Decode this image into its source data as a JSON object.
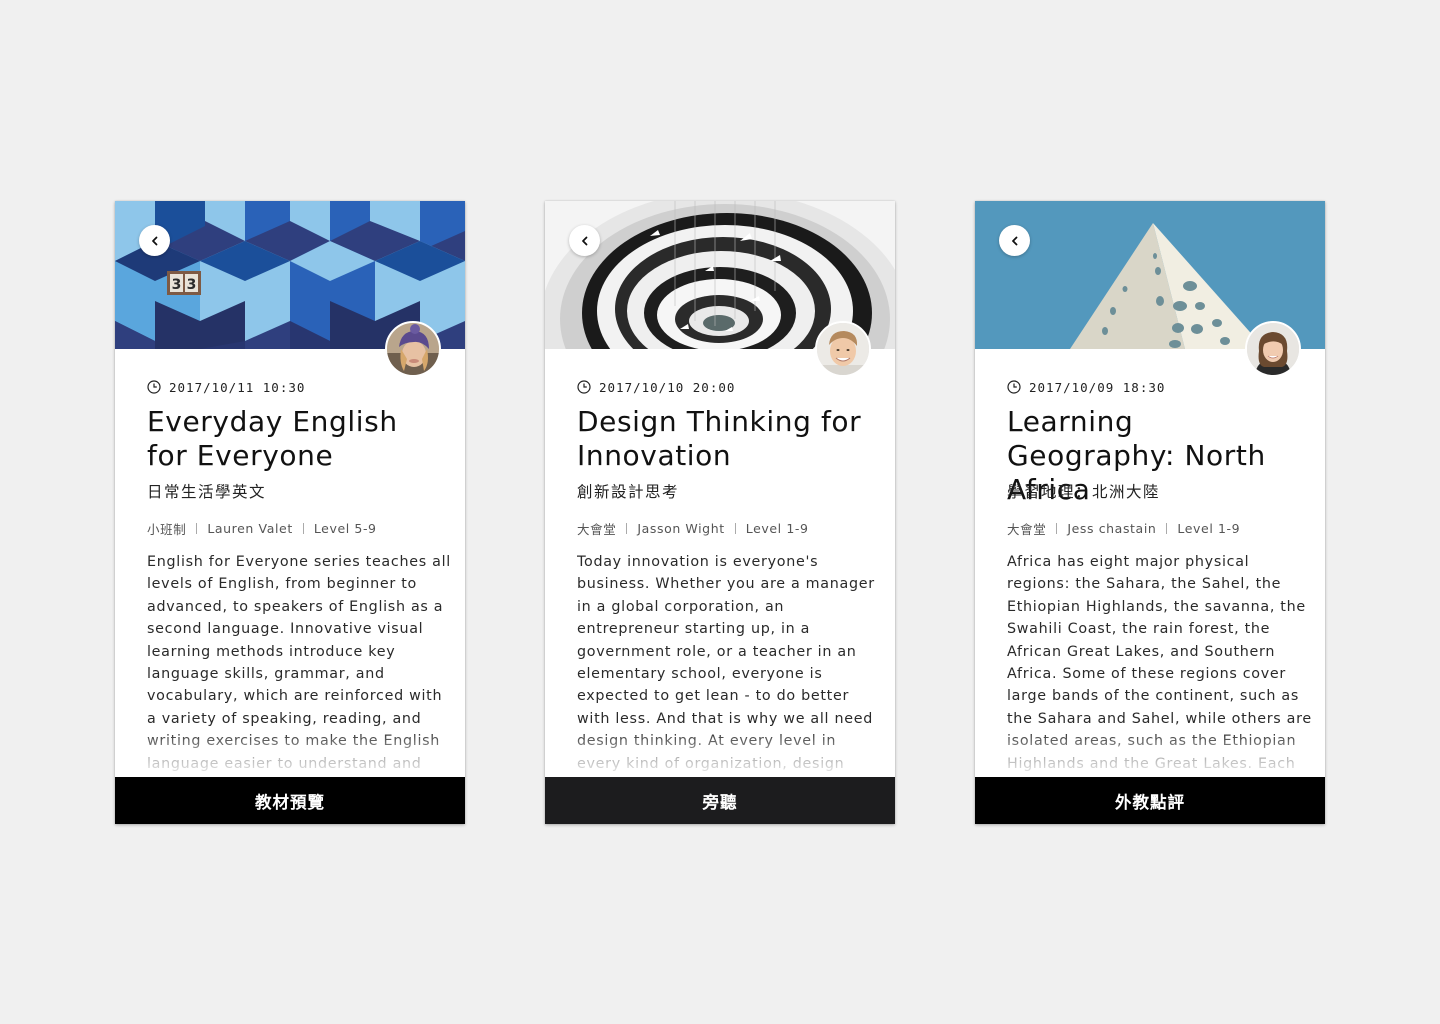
{
  "courses": [
    {
      "datetime": "2017/10/11 10:30",
      "title": "Everyday English for Everyone",
      "subtitle": "日常生活學英文",
      "class_type": "小班制",
      "instructor": "Lauren Valet",
      "level": "Level 5-9",
      "description": "English for Everyone series teaches all levels of English, from beginner to advanced, to speakers of English as a second language. Innovative visual learning methods introduce key language skills, grammar, and vocabulary, which are reinforced with a variety of speaking, reading, and writing exercises to make the English language easier to understand and",
      "action_label": "教材預覽",
      "icons": {
        "back": "chevron-left-icon",
        "clock": "clock-icon"
      },
      "colors": {
        "button_bg": "#000000"
      }
    },
    {
      "datetime": "2017/10/10 20:00",
      "title": "Design Thinking for Innovation",
      "subtitle": "創新設計思考",
      "class_type": "大會堂",
      "instructor": "Jasson Wight",
      "level": "Level 1-9",
      "description": "Today innovation is everyone's business. Whether you are a manager in a global corporation, an entrepreneur starting up, in a government role, or a teacher in an elementary school, everyone is expected to get lean - to do better with less. And that is why we all need design thinking. At every level in every kind of organization, design thinking provides the tools you need to",
      "action_label": "旁聽",
      "icons": {
        "back": "chevron-left-icon",
        "clock": "clock-icon"
      },
      "colors": {
        "button_bg": "#1c1c1e"
      }
    },
    {
      "datetime": "2017/10/09 18:30",
      "title": "Learning Geography: North Africa",
      "subtitle": "學習地理：北洲大陸",
      "class_type": "大會堂",
      "instructor": "Jess chastain",
      "level": "Level 1-9",
      "description": "Africa has eight major physical regions: the Sahara, the Sahel, the Ethiopian Highlands, the savanna, the Swahili Coast, the rain forest, the African Great Lakes, and Southern Africa. Some of these regions cover large bands of the continent, such as the Sahara and Sahel, while others are isolated areas, such as the Ethiopian Highlands and the Great Lakes. Each of these regions has",
      "action_label": "外教點評",
      "icons": {
        "back": "chevron-left-icon",
        "clock": "clock-icon"
      },
      "colors": {
        "button_bg": "#000000"
      }
    }
  ]
}
